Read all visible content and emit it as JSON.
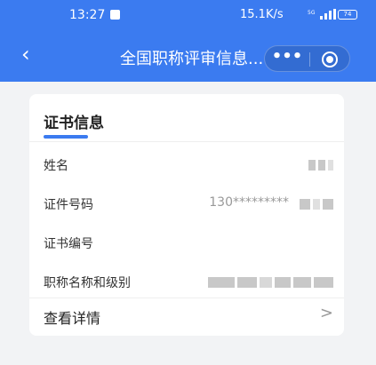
{
  "status_bar": {
    "time": "13:27",
    "network_speed": "15.1K/s",
    "signal": "5G",
    "battery": "74"
  },
  "nav": {
    "title": "全国职称评审信息...",
    "more_label": "•••"
  },
  "card": {
    "title": "证书信息",
    "rows": [
      {
        "label": "姓名",
        "value": ""
      },
      {
        "label": "证件号码",
        "value": "130*********"
      },
      {
        "label": "证书编号",
        "value": ""
      },
      {
        "label": "职称名称和级别",
        "value": ""
      }
    ],
    "detail_label": "查看详情",
    "detail_arrow": ">"
  },
  "colors": {
    "brand_blue": "#3b7bf0",
    "background": "#f2f3f5"
  }
}
